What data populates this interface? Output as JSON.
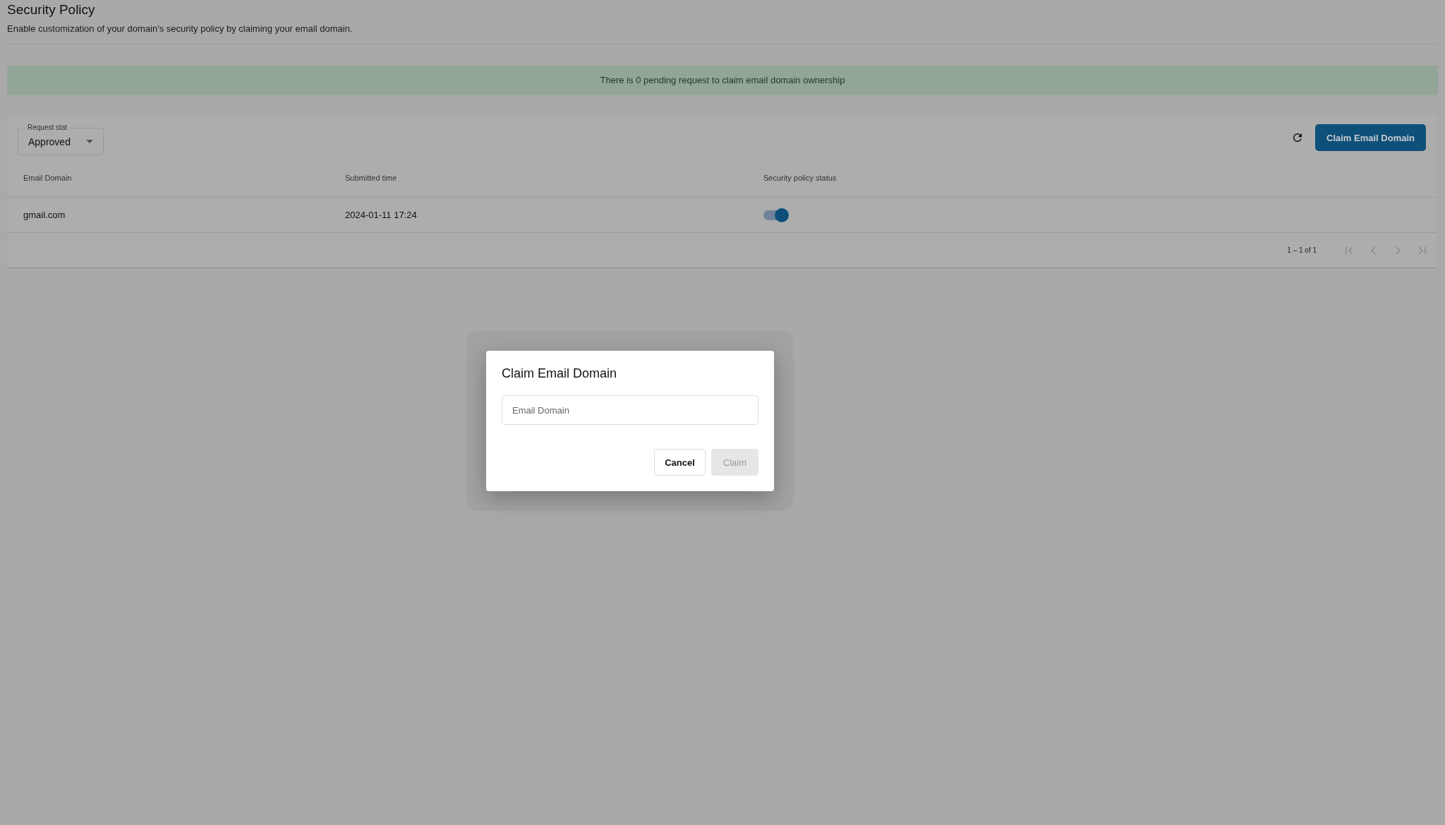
{
  "page": {
    "title": "Security Policy",
    "subtitle": "Enable customization of your domain's security policy by claiming your email domain."
  },
  "banner": {
    "text": "There is 0 pending request to claim email domain ownership"
  },
  "filter": {
    "label": "Request stat",
    "value": "Approved"
  },
  "claim_button": {
    "label": "Claim Email Domain"
  },
  "table": {
    "columns": [
      "Email Domain",
      "Submitted time",
      "Security policy status"
    ],
    "rows": [
      {
        "domain": "gmail.com",
        "submitted": "2024-01-11 17:24",
        "enabled": true
      }
    ],
    "pagination": {
      "range": "1 – 1 of 1"
    }
  },
  "dialog": {
    "title": "Claim Email Domain",
    "field": {
      "placeholder": "Email Domain"
    },
    "buttons": [
      {
        "label": "Cancel",
        "disabled": false
      },
      {
        "label": "Claim",
        "disabled": true
      }
    ]
  }
}
